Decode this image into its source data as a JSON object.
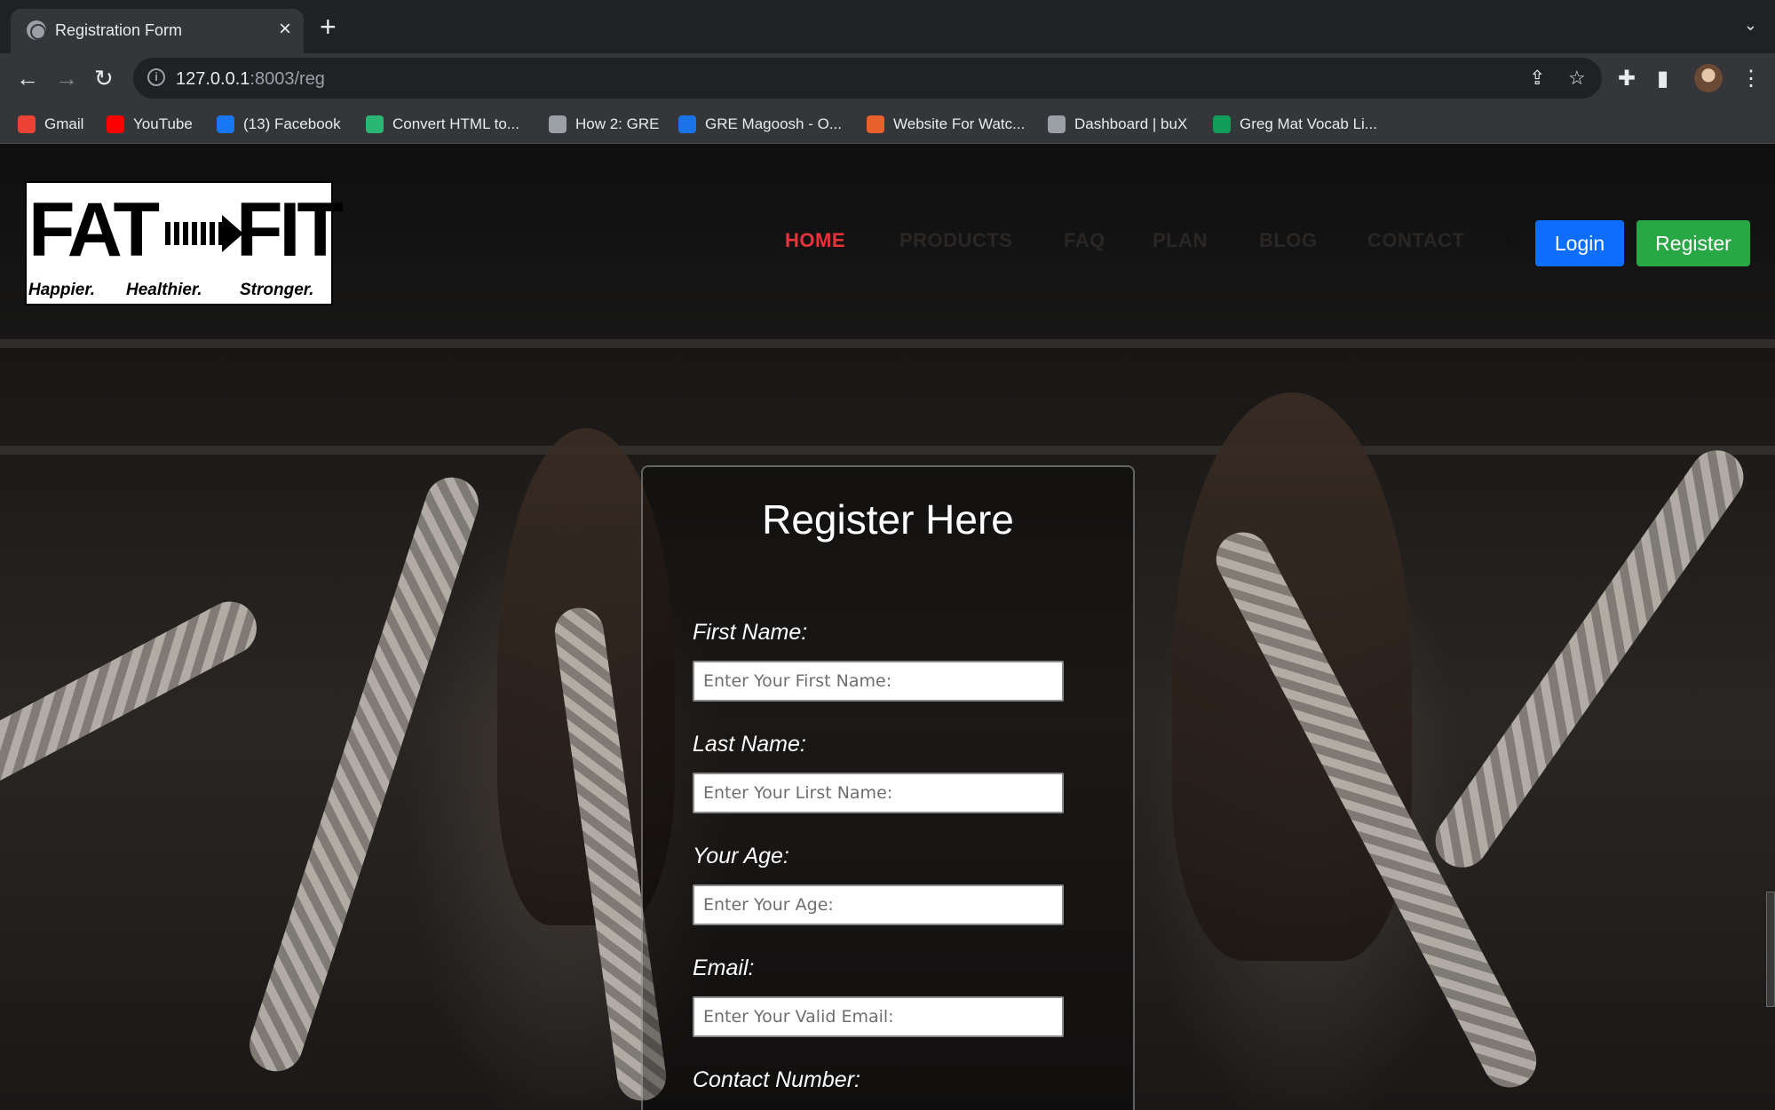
{
  "browser": {
    "tab_title": "Registration Form",
    "url_host": "127.0.0.1",
    "url_rest": ":8003/reg",
    "bookmarks": [
      {
        "label": "Gmail",
        "color": "#ea4335"
      },
      {
        "label": "YouTube",
        "color": "#ff0000"
      },
      {
        "label": "(13) Facebook",
        "color": "#1877f2"
      },
      {
        "label": "Convert HTML to...",
        "color": "#2bb673"
      },
      {
        "label": "How 2: GRE",
        "color": "#9aa0a6"
      },
      {
        "label": "GRE Magoosh - O...",
        "color": "#1a73e8"
      },
      {
        "label": "Website For Watc...",
        "color": "#e8612c"
      },
      {
        "label": "Dashboard | buX",
        "color": "#9aa0a6"
      },
      {
        "label": "Greg Mat Vocab Li...",
        "color": "#0f9d58"
      }
    ]
  },
  "logo": {
    "word_left": "FAT",
    "word_right": "FIT",
    "arrow_text": "to",
    "taglines": [
      "Happier.",
      "Healthier.",
      "Stronger."
    ]
  },
  "nav": {
    "items": [
      "HOME",
      "PRODUCTS",
      "FAQ",
      "PLAN",
      "BLOG",
      "CONTACT"
    ],
    "active": "HOME",
    "login_label": "Login",
    "register_label": "Register"
  },
  "form": {
    "title": "Register Here",
    "fields": [
      {
        "label": "First Name:",
        "placeholder": "Enter Your First Name:"
      },
      {
        "label": "Last Name:",
        "placeholder": "Enter Your Lirst Name:"
      },
      {
        "label": "Your Age:",
        "placeholder": "Enter Your Age:"
      },
      {
        "label": "Email:",
        "placeholder": "Enter Your Valid Email:"
      },
      {
        "label": "Contact Number:",
        "placeholder": ""
      }
    ]
  },
  "colors": {
    "active_nav": "#e8323c",
    "login_button": "#0d6efd",
    "register_button": "#28a745"
  }
}
